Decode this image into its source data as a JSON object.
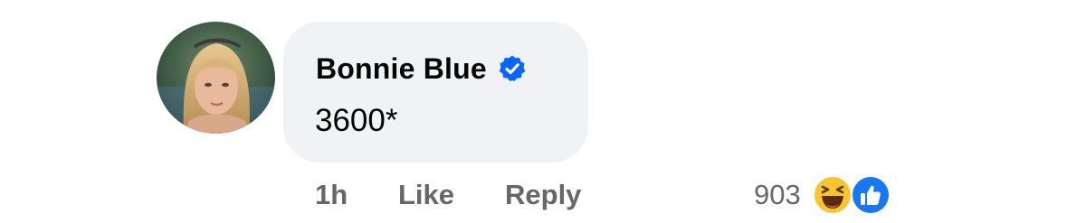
{
  "comment": {
    "author": {
      "name": "Bonnie Blue",
      "verified": true,
      "avatar_icon": "profile-photo"
    },
    "text": "3600*",
    "timestamp": "1h",
    "actions": {
      "like_label": "Like",
      "reply_label": "Reply"
    },
    "reactions": {
      "count": "903",
      "types": [
        "haha-icon",
        "like-icon"
      ]
    }
  },
  "colors": {
    "bubble_bg": "#f0f2f5",
    "verified_blue": "#0866ff",
    "meta_gray": "#65676b",
    "text_dark": "#050505",
    "haha_yellow": "#f7c531",
    "like_blue": "#1877f2"
  }
}
